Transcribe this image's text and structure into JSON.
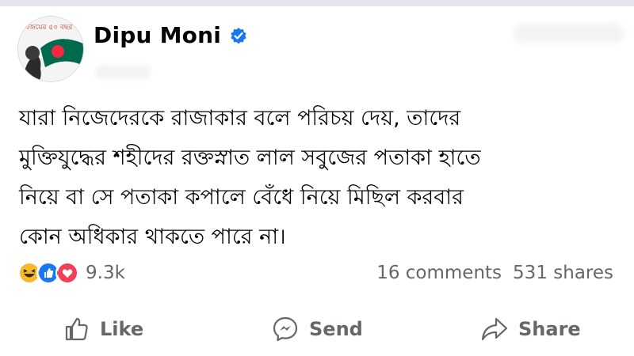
{
  "post": {
    "author": "Dipu Moni",
    "verified": true,
    "avatar_icon": "profile-photo-with-flag",
    "avatar_text": "বিজয়ের ৫০ বছর",
    "text_lines": [
      "যারা নিজেদেরকে রাজাকার বলে পরিচয় দেয়, তাদের",
      "মুক্তিযুদ্ধের শহীদের রক্তস্নাত লাল সবুজের পতাকা হাতে",
      "নিয়ে বা সে পতাকা কপালে বেঁধে নিয়ে মিছিল করবার",
      "কোন অধিকার থাকতে পারে না।"
    ]
  },
  "reactions": {
    "icons": [
      "haha-icon",
      "like-icon",
      "love-icon"
    ],
    "count": "9.3k"
  },
  "stats": {
    "comments": "16 comments",
    "shares": "531 shares"
  },
  "actions": {
    "like": "Like",
    "send": "Send",
    "share": "Share"
  },
  "colors": {
    "verified_blue": "#1877f2",
    "like_blue": "#1877f2",
    "love_red": "#f33e58",
    "haha_yellow": "#f7b928",
    "secondary_text": "#65676b",
    "flag_green": "#006a4e",
    "flag_red": "#f42a41"
  }
}
